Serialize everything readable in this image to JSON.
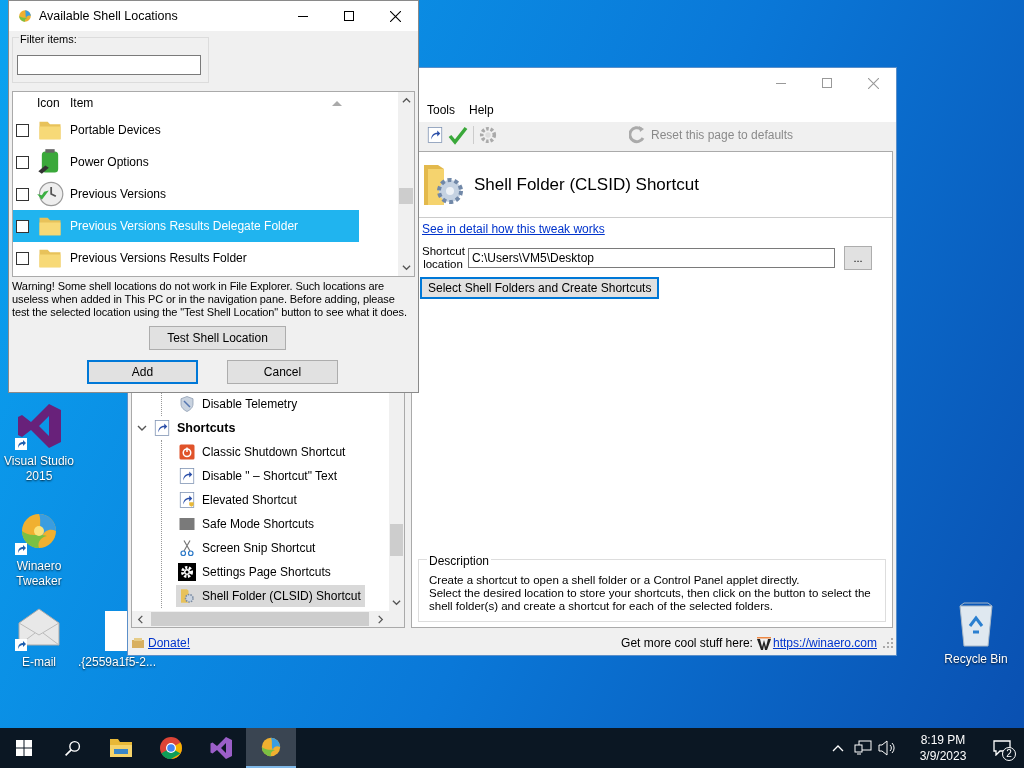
{
  "desktop": {
    "icons": [
      {
        "label": "Visual Studio 2015",
        "kind": "vs",
        "shortcut": true
      },
      {
        "label": "Winaero Tweaker",
        "kind": "winaero",
        "shortcut": true
      },
      {
        "label": "E-mail",
        "kind": "email",
        "shortcut": true
      },
      {
        "label": ".{2559a1f5-2...",
        "kind": "blank",
        "shortcut": false
      },
      {
        "label": "Recycle Bin",
        "kind": "recycle",
        "shortcut": false
      }
    ]
  },
  "main_window": {
    "menu": [
      "Tools",
      "Help"
    ],
    "toolbar": {
      "reset_label": "Reset this page to defaults"
    },
    "tree": [
      {
        "children": [
          {
            "label": "Disable Telemetry",
            "kind": "shield",
            "selected": false
          }
        ]
      },
      {
        "label": "Shortcuts",
        "kind": "shortcut",
        "expanded": true,
        "children": [
          {
            "label": "Classic Shutdown Shortcut",
            "kind": "shutdown",
            "selected": false
          },
          {
            "label": "Disable \" – Shortcut\" Text",
            "kind": "shortcut",
            "selected": false
          },
          {
            "label": "Elevated Shortcut",
            "kind": "elevated",
            "selected": false
          },
          {
            "label": "Safe Mode Shortcuts",
            "kind": "safemode",
            "selected": false
          },
          {
            "label": "Screen Snip Shortcut",
            "kind": "scissors",
            "selected": false
          },
          {
            "label": "Settings Page Shortcuts",
            "kind": "gear",
            "selected": false
          },
          {
            "label": "Shell Folder (CLSID) Shortcut",
            "kind": "shellfolder",
            "selected": true
          }
        ]
      }
    ],
    "page": {
      "title": "Shell Folder (CLSID) Shortcut",
      "detail_link": "See in detail how this tweak works",
      "location_label": "Shortcut location",
      "location_value": "C:\\Users\\VM5\\Desktop",
      "browse_label": "...",
      "action_label": "Select Shell Folders and Create Shortcuts",
      "description_title": "Description",
      "description": [
        "Create a shortcut to open a shell folder or a Control Panel applet directly.",
        "Select the desired location to store your shortcuts, then click on the button to select the shell folder(s) and create a shortcut for each of the selected folders."
      ]
    },
    "status_bar": {
      "donate": "Donate!",
      "promo": "Get more cool stuff here:",
      "url": "https://winaero.com"
    }
  },
  "dialog": {
    "title": "Available Shell Locations",
    "filter_label": "Filter items:",
    "columns": [
      "Icon",
      "Item"
    ],
    "items": [
      {
        "label": "Portable Devices",
        "kind": "folder",
        "checked": false,
        "selected": false
      },
      {
        "label": "Power Options",
        "kind": "power",
        "checked": false,
        "selected": false
      },
      {
        "label": "Previous Versions",
        "kind": "clock",
        "checked": false,
        "selected": false
      },
      {
        "label": "Previous Versions Results Delegate Folder",
        "kind": "folder",
        "checked": false,
        "selected": true
      },
      {
        "label": "Previous Versions Results Folder",
        "kind": "folder",
        "checked": false,
        "selected": false
      }
    ],
    "warning": "Warning! Some shell locations do not work in File Explorer. Such locations are useless when added in This PC or in the navigation pane. Before adding, please test the selected location using the \"Test Shell Location\" button to see what it does.",
    "test_button": "Test Shell Location",
    "buttons": [
      "Add",
      "Cancel"
    ]
  },
  "taskbar": {
    "apps": [
      {
        "kind": "explorer",
        "active": false
      },
      {
        "kind": "chrome",
        "active": false
      },
      {
        "kind": "vs",
        "active": false
      },
      {
        "kind": "winaero",
        "active": true
      }
    ],
    "time": "8:19 PM",
    "date": "3/9/2023",
    "notifications": "2"
  }
}
